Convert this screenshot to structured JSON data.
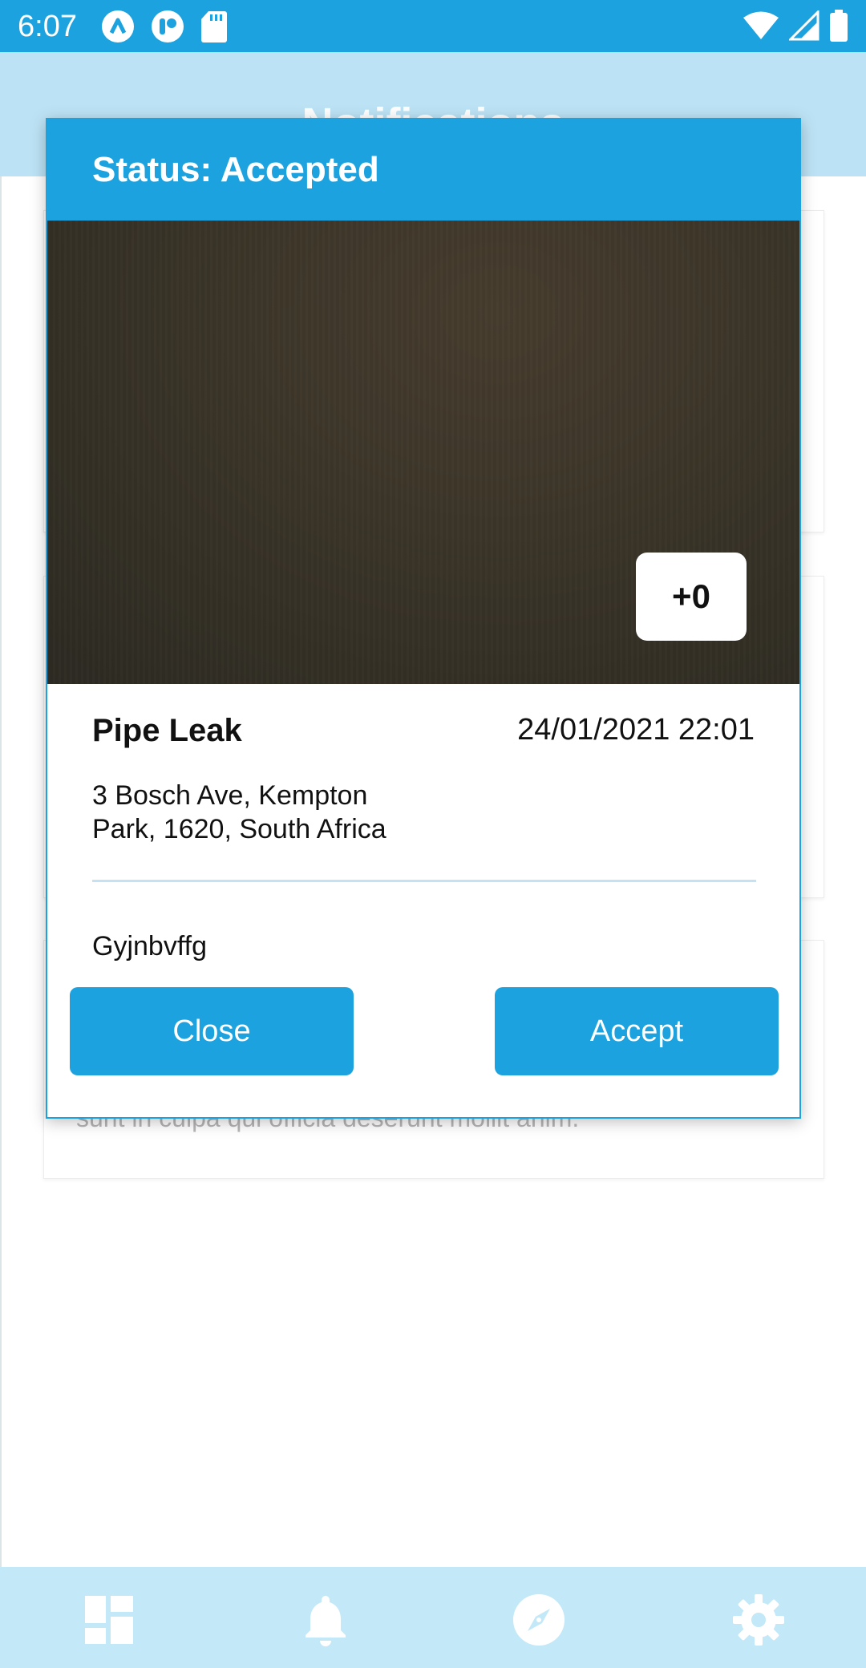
{
  "status_bar": {
    "time": "6:07",
    "left_icons": [
      "arc-app-icon",
      "toggle-app-icon",
      "sd-card-icon"
    ],
    "right_icons": [
      "wifi-icon",
      "cell-signal-icon",
      "battery-icon"
    ],
    "color": "#1ca3df"
  },
  "app": {
    "header_title": "Notifications",
    "background_card_text": "sunt in culpa qui officia deserunt mollit anim."
  },
  "dialog": {
    "status_title": "Status: Accepted",
    "image_count": "+0",
    "issue_title": "Pipe Leak",
    "issue_datetime": "24/01/2021 22:01",
    "address": "3 Bosch Ave, Kempton Park, 1620, South Africa",
    "description": "Gyjnbvffg",
    "close_label": "Close",
    "accept_label": "Accept",
    "accent_color": "#1ca3df"
  },
  "bottom_nav": {
    "items": [
      {
        "icon": "dashboard-icon",
        "active": false
      },
      {
        "icon": "bell-icon",
        "active": true
      },
      {
        "icon": "compass-icon",
        "active": false
      },
      {
        "icon": "gear-icon",
        "active": false
      }
    ]
  }
}
